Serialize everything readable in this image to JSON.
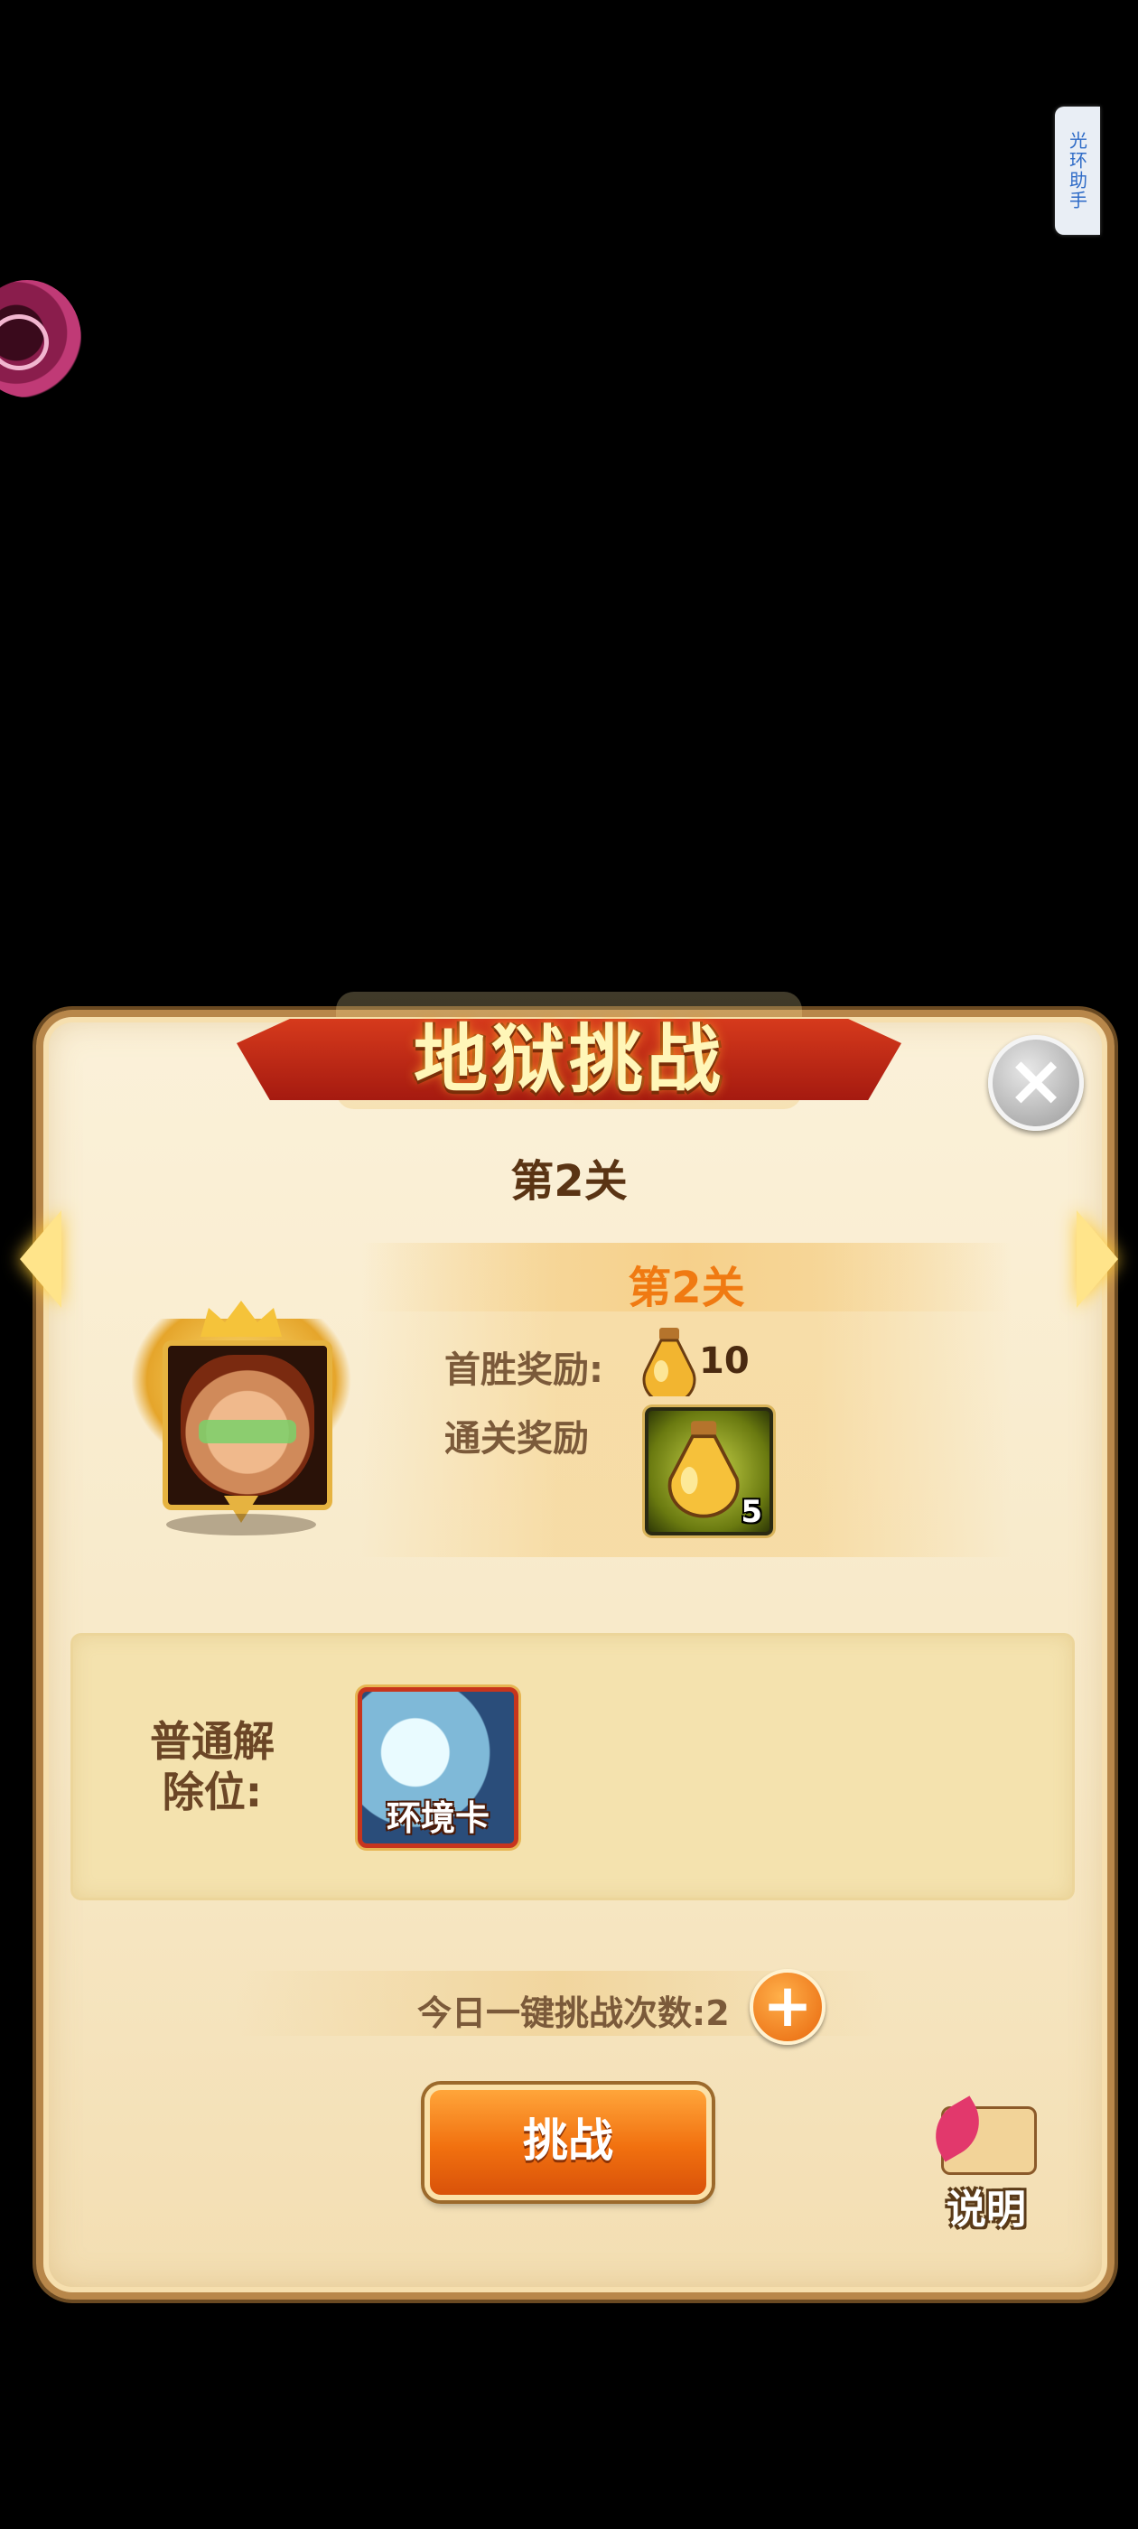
{
  "overlay": {
    "side_tab_label": "光环助手"
  },
  "dialog": {
    "title": "地狱挑战",
    "close_icon": "close-icon",
    "level_title": "第2关",
    "stage": {
      "label": "第2关",
      "first_win_label": "首胜奖励:",
      "first_win_count": "10",
      "clear_reward_label": "通关奖励",
      "clear_reward_count": "5"
    },
    "unlock": {
      "label": "普通解除位:",
      "card_label": "环境卡"
    },
    "daily_count_text": "今日一键挑战次数:2",
    "challenge_button": "挑战",
    "help_button": "说明"
  },
  "colors": {
    "accent_orange": "#f07a12",
    "ribbon_red": "#c02a14",
    "panel_bg": "#f7e8c6"
  }
}
